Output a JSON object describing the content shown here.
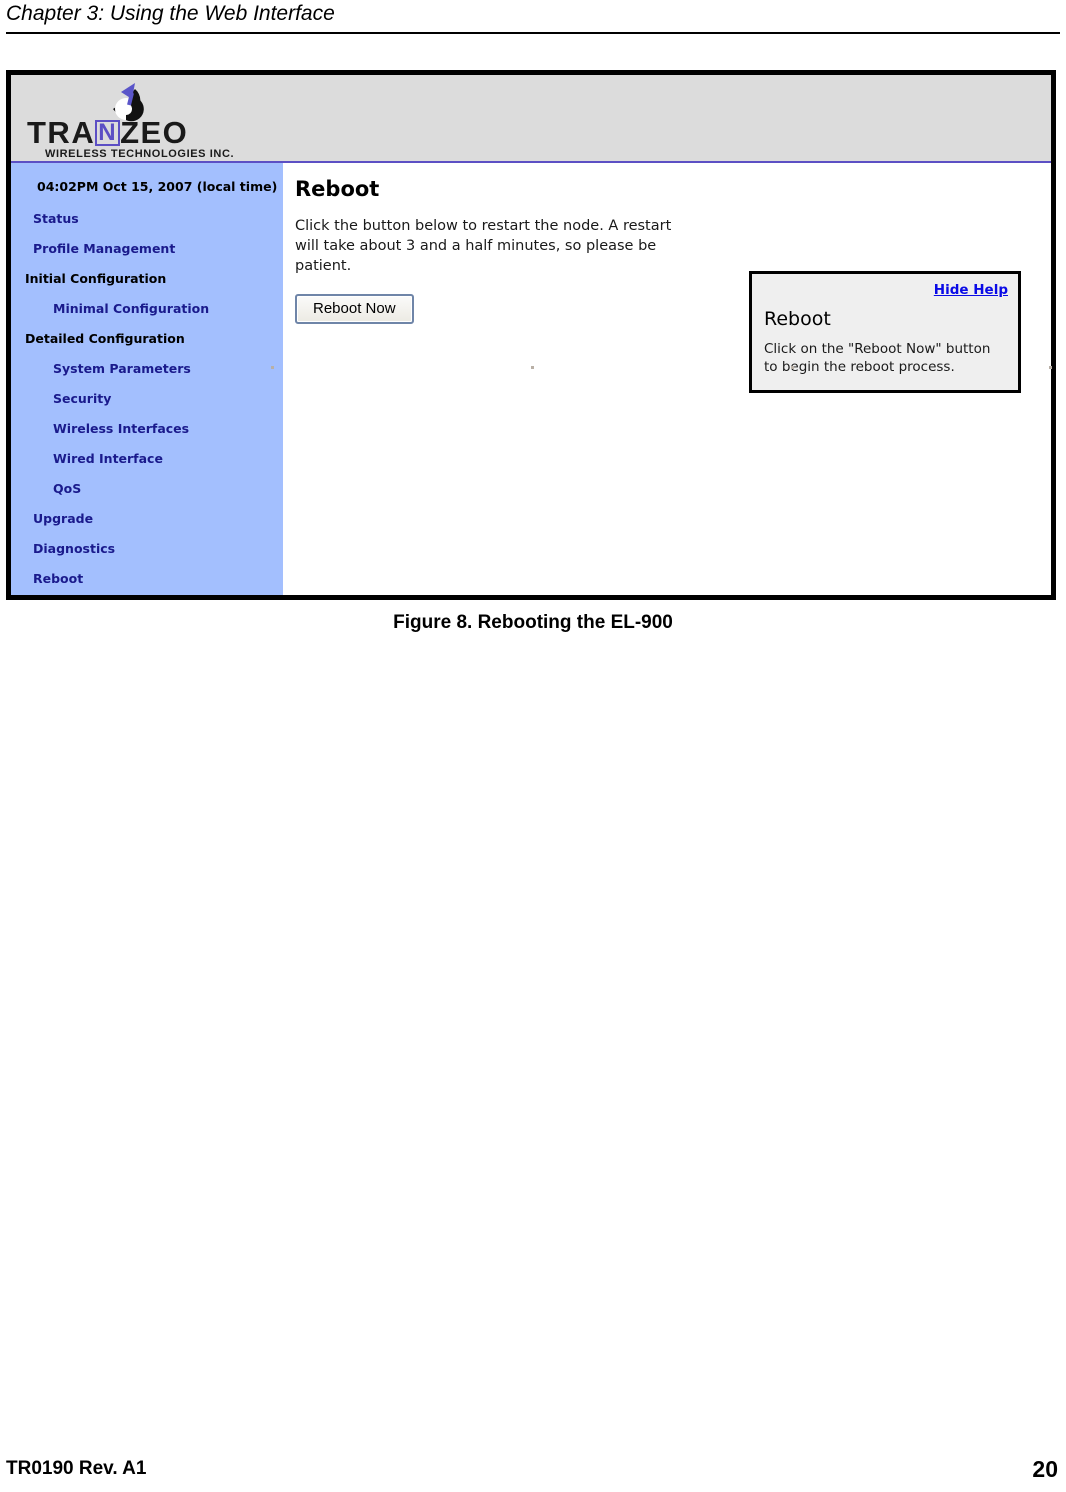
{
  "document": {
    "chapter_title": "Chapter 3: Using the Web Interface",
    "figure_caption": "Figure 8. Rebooting the EL-900",
    "footer_left": "TR0190 Rev. A1",
    "page_number": "20"
  },
  "screenshot": {
    "brand": {
      "wordmark_part1": "TRA",
      "wordmark_n": "N",
      "wordmark_part2": "ZEO",
      "tagline": "WIRELESS  TECHNOLOGIES INC.",
      "dish_icon": "satellite-dish-icon",
      "header_bg": "#DCDCDC",
      "accent": "#5C4FC4"
    },
    "sidebar": {
      "bg": "#A3BFFE",
      "clock": "04:02PM Oct 15, 2007 (local time)",
      "items": [
        {
          "label": "Status",
          "level": "link"
        },
        {
          "label": "Profile Management",
          "level": "link"
        },
        {
          "label": "Initial Configuration",
          "level": "head"
        },
        {
          "label": "Minimal Configuration",
          "level": "sub"
        },
        {
          "label": "Detailed Configuration",
          "level": "head"
        },
        {
          "label": "System Parameters",
          "level": "sub"
        },
        {
          "label": "Security",
          "level": "sub"
        },
        {
          "label": "Wireless Interfaces",
          "level": "sub"
        },
        {
          "label": "Wired Interface",
          "level": "sub"
        },
        {
          "label": "QoS",
          "level": "sub"
        },
        {
          "label": "Upgrade",
          "level": "link"
        },
        {
          "label": "Diagnostics",
          "level": "link"
        },
        {
          "label": "Reboot",
          "level": "link"
        }
      ]
    },
    "main": {
      "title": "Reboot",
      "description": "Click the button below to restart the node. A restart will take about 3 and a half minutes, so please be patient.",
      "reboot_button": "Reboot Now"
    },
    "help": {
      "hide_link": "Hide Help",
      "title": "Reboot",
      "text": "Click on the \"Reboot Now\" button to begin the reboot process.",
      "bg": "#EFEFEF",
      "link_color": "#0A0AE6"
    }
  }
}
